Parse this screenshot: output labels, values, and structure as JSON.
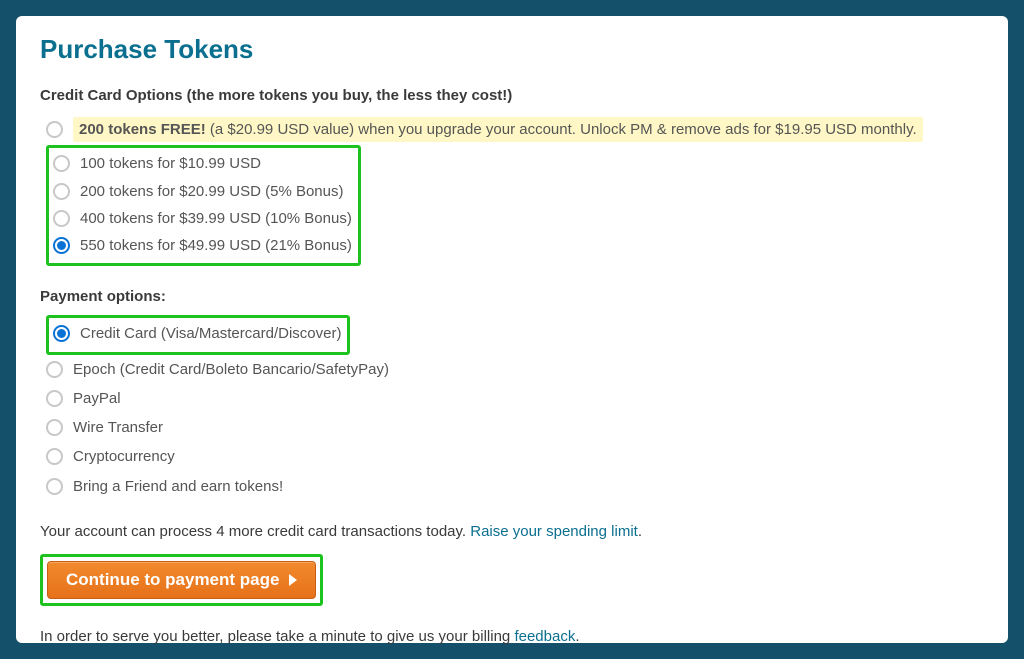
{
  "title": "Purchase Tokens",
  "cc_section_title": "Credit Card Options (the more tokens you buy, the less they cost!)",
  "promo": {
    "bold": "200 tokens FREE!",
    "rest": " (a $20.99 USD value) when you upgrade your account. Unlock PM & remove ads for $19.95 USD monthly."
  },
  "cc_options": [
    {
      "label": "100 tokens for $10.99 USD",
      "selected": false
    },
    {
      "label": "200 tokens for $20.99 USD (5% Bonus)",
      "selected": false
    },
    {
      "label": "400 tokens for $39.99 USD (10% Bonus)",
      "selected": false
    },
    {
      "label": "550 tokens for $49.99 USD (21% Bonus)",
      "selected": true
    }
  ],
  "payment_section_title": "Payment options:",
  "payment_highlighted": {
    "label": "Credit Card (Visa/Mastercard/Discover)",
    "selected": true
  },
  "payment_options": [
    {
      "label": "Epoch (Credit Card/Boleto Bancario/SafetyPay)",
      "selected": false
    },
    {
      "label": "PayPal",
      "selected": false
    },
    {
      "label": "Wire Transfer",
      "selected": false
    },
    {
      "label": "Cryptocurrency",
      "selected": false
    },
    {
      "label": "Bring a Friend and earn tokens!",
      "selected": false
    }
  ],
  "limit_line_pre": "Your account can process 4 more credit card transactions today. ",
  "limit_link": "Raise your spending limit",
  "limit_line_post": ".",
  "continue_btn": "Continue to payment page",
  "footer_pre": "In order to serve you better, please take a minute to give us your billing ",
  "footer_link": "feedback",
  "footer_post": "."
}
